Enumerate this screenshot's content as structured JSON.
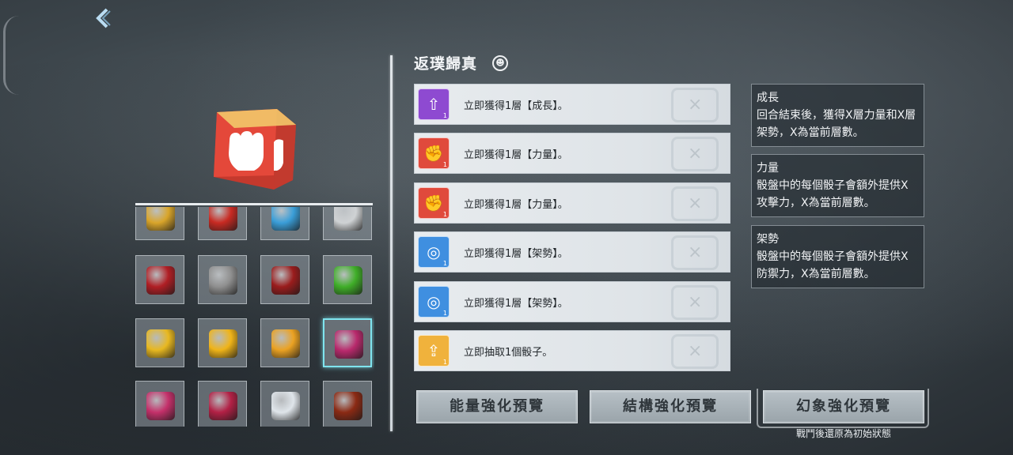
{
  "header": {
    "back_icon": "chevron-left-icon"
  },
  "selected_die": {
    "title": "返璞歸真",
    "info_icon": "mask-icon",
    "icon": "fist-icon",
    "color": "#e04a3c"
  },
  "effects": [
    {
      "text": "立即獲得1層【成長】。",
      "icon": "growth-icon",
      "badge": "1",
      "color": "#8e4ad1"
    },
    {
      "text": "立即獲得1層【力量】。",
      "icon": "fist-icon",
      "badge": "1",
      "color": "#e04a3c"
    },
    {
      "text": "立即獲得1層【力量】。",
      "icon": "fist-icon",
      "badge": "1",
      "color": "#e04a3c"
    },
    {
      "text": "立即獲得1層【架勢】。",
      "icon": "shield-icon",
      "badge": "1",
      "color": "#3f8fe0"
    },
    {
      "text": "立即獲得1層【架勢】。",
      "icon": "shield-icon",
      "badge": "1",
      "color": "#3f8fe0"
    },
    {
      "text": "立即抽取1個骰子。",
      "icon": "draw-icon",
      "badge": "1",
      "color": "#f0b23c"
    }
  ],
  "keywords": [
    {
      "title": "成長",
      "desc": "回合結束後，獲得X層力量和X層架勢，X為當前層數。"
    },
    {
      "title": "力量",
      "desc": "骰盤中的每個骰子會額外提供X攻擊力，X為當前層數。"
    },
    {
      "title": "架勢",
      "desc": "骰盤中的每個骰子會額外提供X防禦力，X為當前層數。"
    }
  ],
  "buttons": {
    "energy": "能量強化預覽",
    "structure": "結構強化預覽",
    "phantom": "幻象強化預覽",
    "phantom_note": "戰鬥後還原為初始狀態"
  },
  "dice_grid": [
    {
      "name": "gold-die",
      "color": "#d9a52a"
    },
    {
      "name": "red-gem-die",
      "color": "#c82a22"
    },
    {
      "name": "blue-gem-die",
      "color": "#3a9ed8"
    },
    {
      "name": "grid-die",
      "color": "#cfd2d4"
    },
    {
      "name": "ruby-die",
      "color": "#b01e24"
    },
    {
      "name": "silver-amber-die",
      "color": "#8f8f8f"
    },
    {
      "name": "dark-red-die",
      "color": "#9a1c1c"
    },
    {
      "name": "green-die",
      "color": "#3fae28"
    },
    {
      "name": "gold-spiky-die",
      "color": "#e8b820"
    },
    {
      "name": "gold-cube-die",
      "color": "#f0b418"
    },
    {
      "name": "gold-flame-die",
      "color": "#eba222"
    },
    {
      "name": "magenta-crystal-die",
      "color": "#b8296c"
    },
    {
      "name": "pink-crystal-die",
      "color": "#c4306a"
    },
    {
      "name": "crimson-die",
      "color": "#b22045"
    },
    {
      "name": "white-blue-die",
      "color": "#dfe5ea"
    },
    {
      "name": "lava-die",
      "color": "#8b2a14"
    }
  ],
  "selected_cell_index": 11
}
